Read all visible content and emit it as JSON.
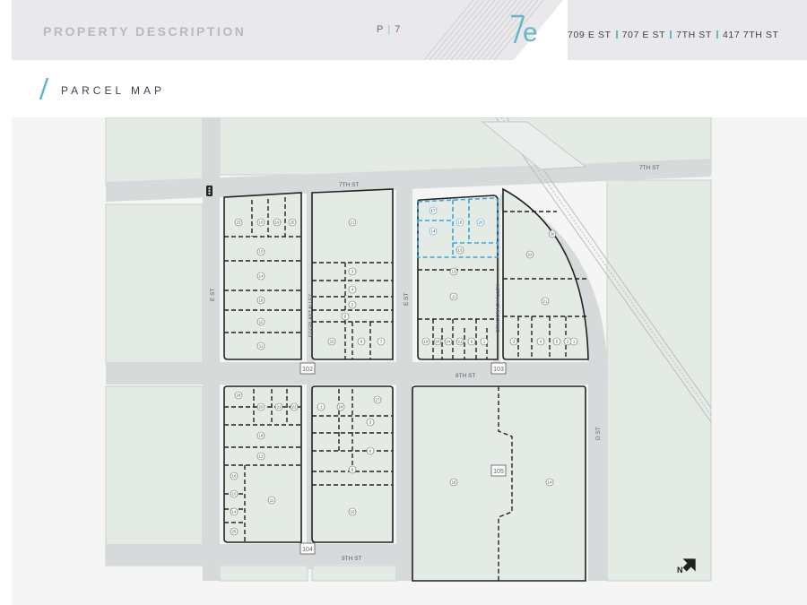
{
  "header": {
    "title": "PROPERTY DESCRIPTION",
    "page_prefix": "P",
    "page_number": "7",
    "logo_text": "7e",
    "addresses": [
      "709 E ST",
      "707 E ST",
      "7TH ST",
      "417 7TH ST"
    ],
    "accent_color": "#62b9c6"
  },
  "section": {
    "title": "PARCEL MAP"
  },
  "map": {
    "streets": {
      "seventh_left": "7TH ST",
      "seventh_right": "7TH ST",
      "eighth": "8TH ST",
      "ninth": "9TH ST",
      "e_left": "E ST",
      "e_mid": "E ST",
      "d": "D ST",
      "eggplant": "EGGPLANT ALLEY",
      "democracy": "DEMOCRACY ALLEY"
    },
    "block_numbers": [
      "102",
      "103",
      "104",
      "105"
    ],
    "north_label": "N",
    "lot_numbers": {
      "b102": [
        "23",
        "18",
        "19",
        "20",
        "15",
        "14",
        "16",
        "12",
        "11",
        "21",
        "3",
        "4",
        "5",
        "6",
        "22",
        "8",
        "7"
      ],
      "b103": [
        "17",
        "18",
        "20",
        "14",
        "15",
        "13",
        "11",
        "19",
        "20",
        "24",
        "21",
        "6",
        "1",
        "3",
        "4",
        "5",
        "1",
        "30",
        "22",
        "21",
        "2"
      ],
      "b104": [
        "24",
        "20",
        "21",
        "22",
        "18",
        "12",
        "16",
        "10",
        "14",
        "25",
        "11",
        "1",
        "24",
        "27",
        "5",
        "6",
        "9",
        "10"
      ],
      "b105": [
        "16",
        "14"
      ]
    },
    "highlighted_lots": [
      "17",
      "18",
      "20",
      "14"
    ]
  }
}
